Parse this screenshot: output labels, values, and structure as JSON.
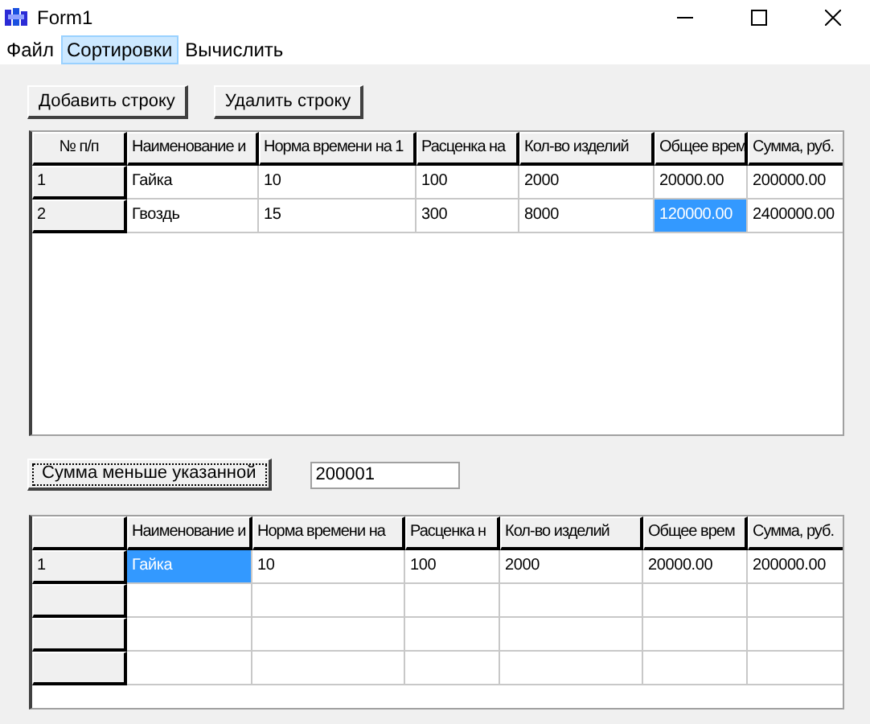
{
  "window": {
    "title": "Form1"
  },
  "menu": [
    {
      "label": "Файл",
      "selected": false
    },
    {
      "label": "Сортировки",
      "selected": true
    },
    {
      "label": "Вычислить",
      "selected": false
    }
  ],
  "top_buttons": [
    "Добавить строку",
    "Удалить строку"
  ],
  "grid_1": {
    "columns": [
      "№ п/п",
      "Наименование и",
      "Норма времени на 1",
      "Расценка на",
      "Кол-во изделий",
      "Общее врем",
      "Сумма, руб."
    ],
    "rows": [
      {
        "cells": [
          {
            "text": "1",
            "selected": false
          },
          {
            "text": "Гайка",
            "selected": false
          },
          {
            "text": "10",
            "selected": false
          },
          {
            "text": "100",
            "selected": false
          },
          {
            "text": "2000",
            "selected": false
          },
          {
            "text": "20000.00",
            "selected": false
          },
          {
            "text": "200000.00",
            "selected": false
          }
        ]
      },
      {
        "cells": [
          {
            "text": "2",
            "selected": false
          },
          {
            "text": "Гвоздь",
            "selected": false
          },
          {
            "text": "15",
            "selected": false
          },
          {
            "text": "300",
            "selected": false
          },
          {
            "text": "8000",
            "selected": false
          },
          {
            "text": "120000.00",
            "selected": true
          },
          {
            "text": "2400000.00",
            "selected": false
          }
        ]
      }
    ]
  },
  "filter": {
    "button": "Сумма меньше указанной",
    "value": "200001"
  },
  "grid_2": {
    "columns": [
      "",
      "Наименование и",
      "Норма времени на",
      "Расценка н",
      "Кол-во изделий",
      "Общее врем",
      "Сумма, руб."
    ],
    "rows": [
      {
        "cells": [
          {
            "text": "1",
            "selected": false
          },
          {
            "text": "Гайка",
            "selected": true
          },
          {
            "text": "10",
            "selected": false
          },
          {
            "text": "100",
            "selected": false
          },
          {
            "text": "2000",
            "selected": false
          },
          {
            "text": "20000.00",
            "selected": false
          },
          {
            "text": "200000.00",
            "selected": false
          }
        ]
      }
    ]
  }
}
